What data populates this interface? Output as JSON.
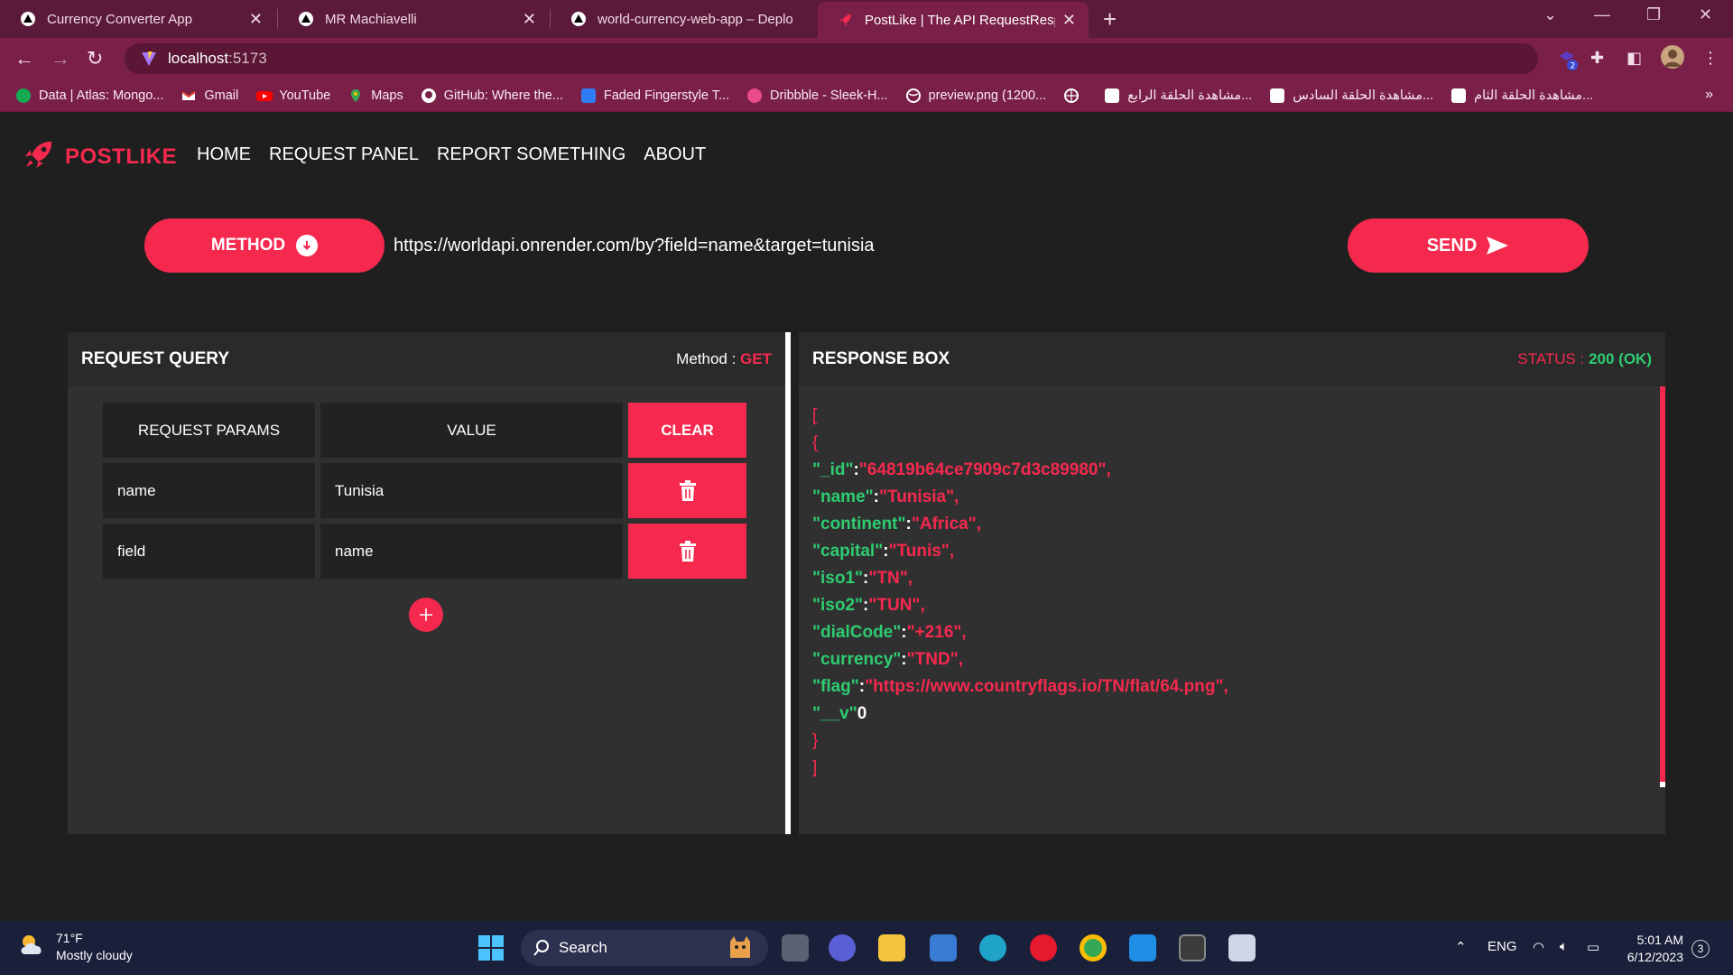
{
  "browser": {
    "tabs": [
      {
        "title": "Currency Converter App",
        "icon": "triangle-logo-icon",
        "active": false
      },
      {
        "title": "MR Machiavelli",
        "icon": "triangle-logo-icon",
        "active": false
      },
      {
        "title": "world-currency-web-app – Deplo",
        "icon": "triangle-logo-icon",
        "active": false
      },
      {
        "title": "PostLike | The API RequestRespon",
        "icon": "rocket-icon",
        "active": true
      }
    ],
    "url_host": "localhost",
    "url_port": ":5173",
    "bookmarks": [
      {
        "label": "Data | Atlas: Mongo...",
        "color": "#13aa52"
      },
      {
        "label": "Gmail",
        "color": "#ea4335"
      },
      {
        "label": "YouTube",
        "color": "#ff0000"
      },
      {
        "label": "Maps",
        "color": "#34a853"
      },
      {
        "label": "GitHub: Where the...",
        "color": "#ffffff"
      },
      {
        "label": "Faded Fingerstyle T...",
        "color": "#2f7df6"
      },
      {
        "label": "Dribbble - Sleek-H...",
        "color": "#ea4c89"
      },
      {
        "label": "preview.png (1200...",
        "color": "#ffffff"
      },
      {
        "label": "",
        "color": "#ffffff"
      },
      {
        "label": "مشاهدة الحلقة الرابع...",
        "color": "#ffffff"
      },
      {
        "label": "مشاهدة الحلقة السادس...",
        "color": "#ffffff"
      },
      {
        "label": "مشاهدة الحلقة الثام...",
        "color": "#ffffff"
      }
    ],
    "more": "»"
  },
  "app": {
    "brand": "POSTLIKE",
    "nav": [
      "HOME",
      "REQUEST PANEL",
      "REPORT SOMETHING",
      "ABOUT"
    ],
    "method_button": "METHOD",
    "url_value": "https://worldapi.onrender.com/by?field=name&target=tunisia",
    "send_button": "SEND",
    "accent": "#f5294e",
    "success": "#2ecc71"
  },
  "request_panel": {
    "title": "REQUEST QUERY",
    "method_label": "Method : ",
    "method_value": "GET",
    "headers": {
      "param": "REQUEST PARAMS",
      "value": "VALUE",
      "clear": "CLEAR"
    },
    "rows": [
      {
        "param": "name",
        "value": "Tunisia"
      },
      {
        "param": "field",
        "value": "name"
      }
    ]
  },
  "response_panel": {
    "title": "RESPONSE BOX",
    "status_label": "STATUS : ",
    "status_value": "200 (OK)",
    "open_bracket": "[",
    "open_brace": "{",
    "fields": [
      {
        "key": "\"_id\"",
        "sep": ":",
        "value": "\"64819b64ce7909c7d3c89980\",",
        "type": "string"
      },
      {
        "key": "\"name\"",
        "sep": ":",
        "value": "\"Tunisia\",",
        "type": "string"
      },
      {
        "key": "\"continent\"",
        "sep": ":",
        "value": "\"Africa\",",
        "type": "string"
      },
      {
        "key": "\"capital\"",
        "sep": ":",
        "value": "\"Tunis\",",
        "type": "string"
      },
      {
        "key": "\"iso1\"",
        "sep": ":",
        "value": "\"TN\",",
        "type": "string"
      },
      {
        "key": "\"iso2\"",
        "sep": ":",
        "value": "\"TUN\",",
        "type": "string"
      },
      {
        "key": "\"dialCode\"",
        "sep": ":",
        "value": "\"+216\",",
        "type": "string"
      },
      {
        "key": "\"currency\"",
        "sep": ":",
        "value": "\"TND\",",
        "type": "string"
      },
      {
        "key": "\"flag\"",
        "sep": ":",
        "value": "\"https://www.countryflags.io/TN/flat/64.png\",",
        "type": "string"
      },
      {
        "key": "\"__v\"",
        "sep": "",
        "value": "0",
        "type": "number"
      }
    ],
    "close_brace": "}",
    "close_bracket": "]"
  },
  "taskbar": {
    "weather_temp": "71°F",
    "weather_desc": "Mostly cloudy",
    "search_label": "Search",
    "language": "ENG",
    "time": "5:01 AM",
    "date": "6/12/2023",
    "notifications": "3"
  }
}
